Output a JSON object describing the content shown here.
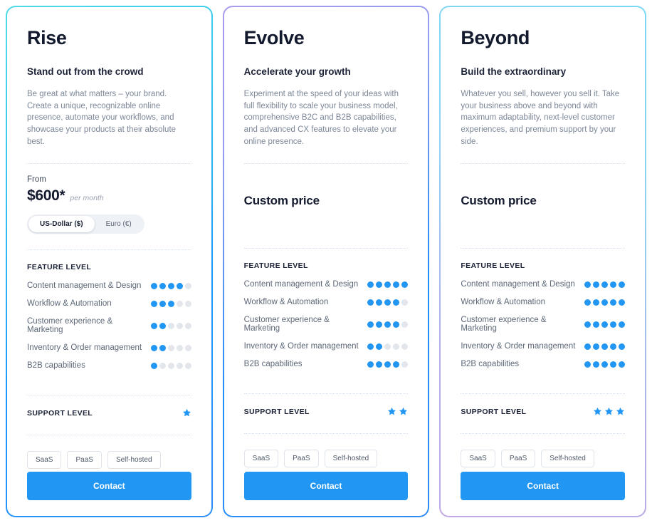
{
  "feature_labels": [
    "Content management & Design",
    "Workflow & Automation",
    "Customer experience & Marketing",
    "Inventory & Order management",
    "B2B capabilities"
  ],
  "section_labels": {
    "feature_level": "FEATURE LEVEL",
    "support_level": "SUPPORT LEVEL"
  },
  "colors": {
    "accent": "#2196f3",
    "dot_on": "#2196f3",
    "dot_off": "#e3e7ec",
    "star": "#2196f3",
    "heading": "#131a2e",
    "body_text": "#7c8798",
    "card1_border_from": "#4ddbe8",
    "card1_border_to": "#2b90f7",
    "card2_border_from": "#a99bec",
    "card2_border_to": "#2f8df5",
    "card3_border_from": "#7ad8f5",
    "card3_border_to": "#c0a8e6"
  },
  "dot_total": 5,
  "cards": [
    {
      "name": "Rise",
      "tagline": "Stand out from the crowd",
      "description": "Be great at what matters – your brand. Create a unique, recognizable online presence, automate your workflows, and showcase your products at their absolute best.",
      "price_type": "from",
      "price_from_label": "From",
      "price_amount": "$600*",
      "price_period": "per month",
      "currency_options": [
        "US-Dollar ($)",
        "Euro (€)"
      ],
      "currency_selected": "US-Dollar ($)",
      "feature_levels": [
        4,
        3,
        2,
        2,
        1
      ],
      "support_level": 1,
      "deployment_tags": [
        "SaaS",
        "PaaS",
        "Self-hosted"
      ],
      "cta_label": "Contact"
    },
    {
      "name": "Evolve",
      "tagline": "Accelerate your growth",
      "description": "Experiment at the speed of your ideas with full flexibility to scale your business model, comprehensive B2C and B2B capabilities, and advanced CX features to elevate your online presence.",
      "price_type": "custom",
      "custom_price_label": "Custom price",
      "feature_levels": [
        5,
        4,
        4,
        2,
        4
      ],
      "support_level": 2,
      "deployment_tags": [
        "SaaS",
        "PaaS",
        "Self-hosted"
      ],
      "cta_label": "Contact"
    },
    {
      "name": "Beyond",
      "tagline": "Build the extraordinary",
      "description": "Whatever you sell, however you sell it. Take your business above and beyond with maximum adaptability, next-level customer experiences, and premium support by your side.",
      "price_type": "custom",
      "custom_price_label": "Custom price",
      "feature_levels": [
        5,
        5,
        5,
        5,
        5
      ],
      "support_level": 3,
      "deployment_tags": [
        "SaaS",
        "PaaS",
        "Self-hosted"
      ],
      "cta_label": "Contact"
    }
  ]
}
